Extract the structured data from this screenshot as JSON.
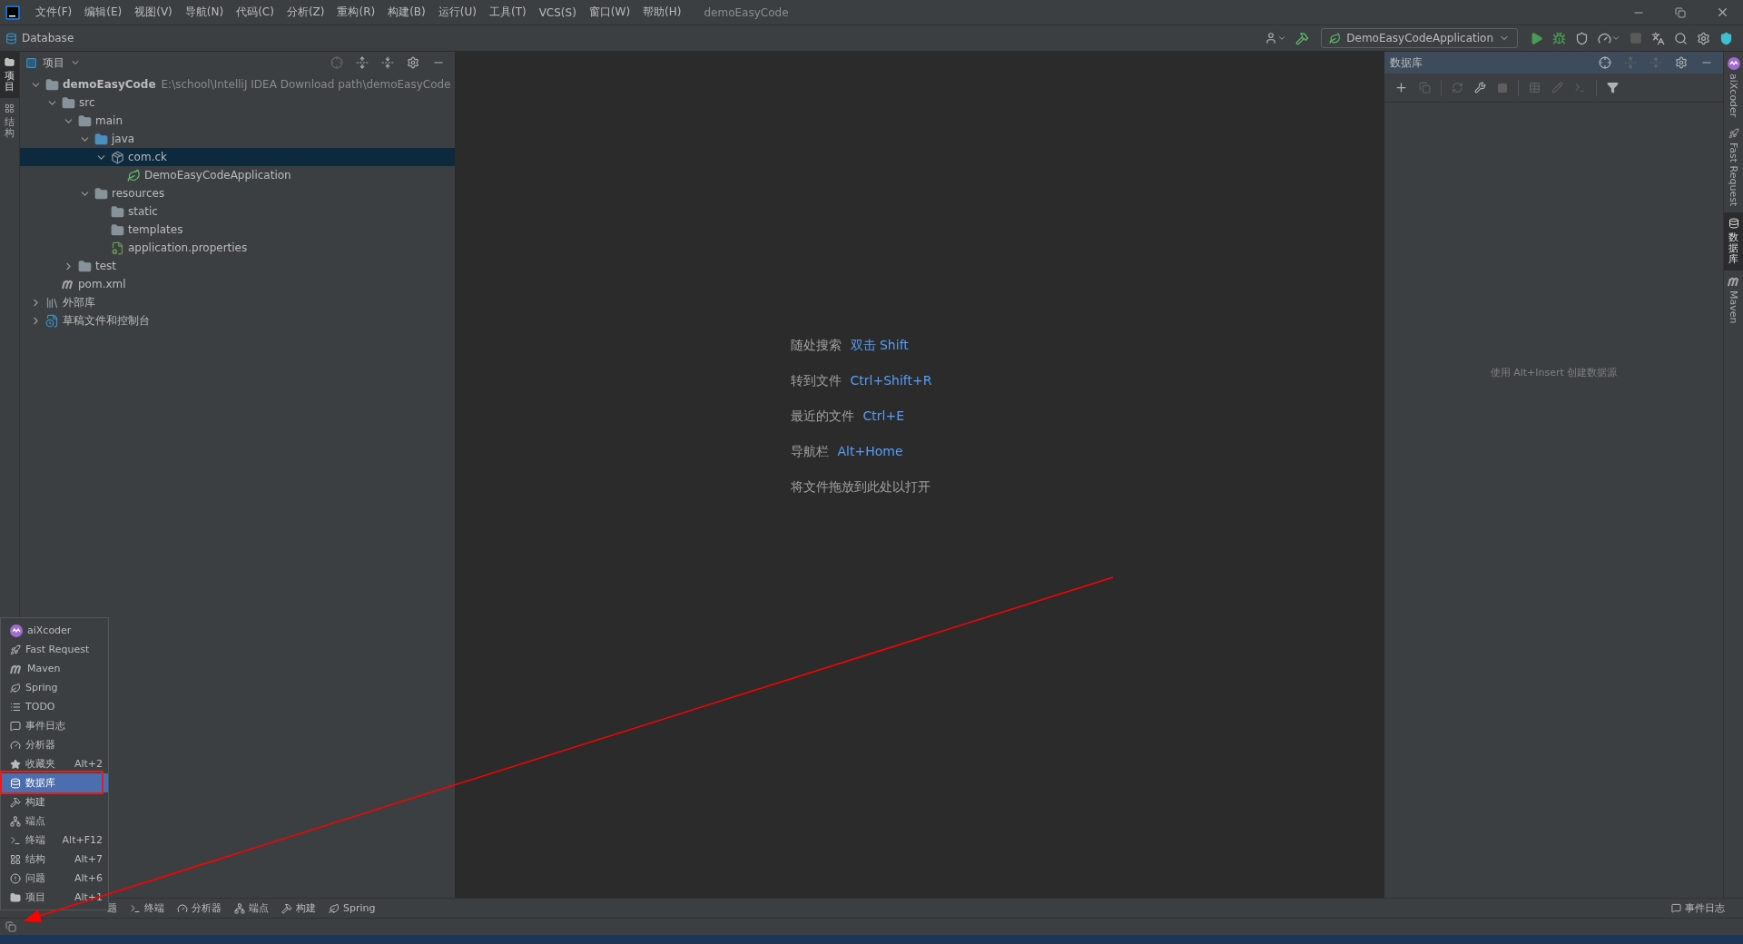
{
  "menu_bar": {
    "items": [
      "文件(F)",
      "编辑(E)",
      "视图(V)",
      "导航(N)",
      "代码(C)",
      "分析(Z)",
      "重构(R)",
      "构建(B)",
      "运行(U)",
      "工具(T)",
      "VCS(S)",
      "窗口(W)",
      "帮助(H)"
    ],
    "project_title": "demoEasyCode"
  },
  "nav_bar": {
    "breadcrumb": "Database",
    "run_config": "DemoEasyCodeApplication"
  },
  "left_stripe": [
    {
      "label": "项目",
      "selected": true
    },
    {
      "label": "结构",
      "selected": false
    }
  ],
  "project_panel": {
    "title": "项目",
    "tree": [
      {
        "label": "demoEasyCode",
        "hint": "E:\\school\\IntelliJ IDEA Download path\\demoEasyCode",
        "kind": "module",
        "expanded": true,
        "selected": false,
        "children": [
          {
            "label": "src",
            "kind": "folder",
            "expanded": true,
            "selected": false,
            "children": [
              {
                "label": "main",
                "kind": "folder",
                "expanded": true,
                "selected": false,
                "children": [
                  {
                    "label": "java",
                    "kind": "source",
                    "expanded": true,
                    "selected": false,
                    "children": [
                      {
                        "label": "com.ck",
                        "kind": "package",
                        "expanded": true,
                        "selected": true,
                        "children": [
                          {
                            "label": "DemoEasyCodeApplication",
                            "kind": "spring-class",
                            "selected": false
                          }
                        ]
                      }
                    ]
                  },
                  {
                    "label": "resources",
                    "kind": "resources",
                    "expanded": true,
                    "selected": false,
                    "children": [
                      {
                        "label": "static",
                        "kind": "folder",
                        "selected": false
                      },
                      {
                        "label": "templates",
                        "kind": "folder",
                        "selected": false
                      },
                      {
                        "label": "application.properties",
                        "kind": "spring-config",
                        "selected": false
                      }
                    ]
                  }
                ]
              },
              {
                "label": "test",
                "kind": "folder",
                "expanded": false,
                "selected": false
              }
            ]
          },
          {
            "label": "pom.xml",
            "kind": "maven",
            "selected": false
          }
        ]
      },
      {
        "label": "外部库",
        "kind": "library",
        "expanded": false,
        "selected": false
      },
      {
        "label": "草稿文件和控制台",
        "kind": "scratch",
        "expanded": false,
        "selected": false
      }
    ]
  },
  "editor": {
    "hints": [
      {
        "label": "随处搜索",
        "shortcut": "双击 Shift"
      },
      {
        "label": "转到文件",
        "shortcut": "Ctrl+Shift+R"
      },
      {
        "label": "最近的文件",
        "shortcut": "Ctrl+E"
      },
      {
        "label": "导航栏",
        "shortcut": "Alt+Home"
      },
      {
        "label": "将文件拖放到此处以打开"
      }
    ]
  },
  "database_panel": {
    "title": "数据库",
    "empty_text": "使用 Alt+Insert 创建数据源"
  },
  "right_stripe": [
    {
      "label": "aiXcoder",
      "selected": false
    },
    {
      "label": "Fast Request",
      "selected": false
    },
    {
      "label": "数据库",
      "selected": true
    },
    {
      "label": "Maven",
      "selected": false
    }
  ],
  "tool_window_popup": {
    "items": [
      {
        "label": "aiXcoder",
        "selected": false
      },
      {
        "label": "Fast Request",
        "selected": false
      },
      {
        "label": "Maven",
        "selected": false
      },
      {
        "label": "Spring",
        "selected": false
      },
      {
        "label": "TODO",
        "selected": false
      },
      {
        "label": "事件日志",
        "selected": false
      },
      {
        "label": "分析器",
        "selected": false
      },
      {
        "label": "收藏夹",
        "shortcut": "Alt+2",
        "selected": false
      },
      {
        "label": "数据库",
        "selected": true
      },
      {
        "label": "构建",
        "selected": false
      },
      {
        "label": "端点",
        "selected": false
      },
      {
        "label": "终端",
        "shortcut": "Alt+F12",
        "selected": false
      },
      {
        "label": "结构",
        "shortcut": "Alt+7",
        "selected": false
      },
      {
        "label": "问题",
        "shortcut": "Alt+6",
        "selected": false
      },
      {
        "label": "项目",
        "shortcut": "Alt+1",
        "selected": false
      }
    ]
  },
  "bottom_bar": {
    "left": [
      "题",
      "终端",
      "分析器",
      "端点",
      "构建",
      "Spring"
    ],
    "right": [
      "事件日志"
    ]
  }
}
